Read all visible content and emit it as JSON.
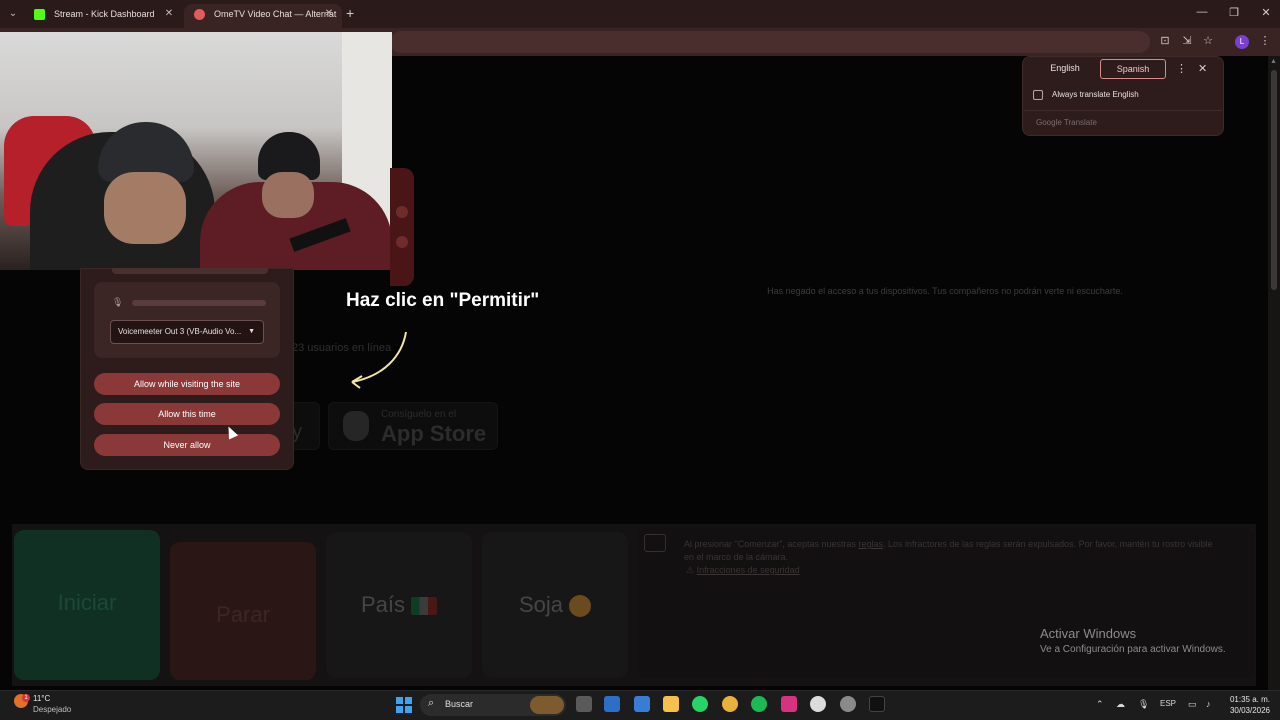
{
  "browser": {
    "tabs": [
      {
        "title": "Stream - Kick Dashboard",
        "active": false
      },
      {
        "title": "OmeTV Video Chat — Alternat",
        "active": true
      }
    ]
  },
  "page": {
    "denied_message": "Has negado el acceso a tus dispositivos. Tus compañeros no podrán verte ni escucharte.",
    "online_count": "23 usuarios en línea",
    "app_store": {
      "small": "Consíguelo en el",
      "big": "App Store"
    },
    "google_play_fragment": "by",
    "controls": {
      "start": "Iniciar",
      "stop": "Parar",
      "country": "País",
      "gender": "Soja"
    },
    "terms": {
      "text_before_link": "Al presionar \"Comenzar\", aceptas nuestras ",
      "link": "reglas",
      "text_after_link": ". Los infractores de las reglas serán expulsados. Por favor, mantén tu rostro visible en el marco de la cámara.",
      "rules_link": "Infracciones de seguridad"
    },
    "hint": "Haz clic en \"Permitir\""
  },
  "permission_dialog": {
    "device_select": "Voicemeeter Out 3 (VB-Audio Vo...",
    "buttons": {
      "allow_visit": "Allow while visiting the site",
      "allow_once": "Allow this time",
      "never": "Never allow"
    }
  },
  "translate_popup": {
    "lang_from": "English",
    "lang_to": "Spanish",
    "always_label": "Always translate English",
    "brand": "Google Translate"
  },
  "watermark": {
    "title": "Activar Windows",
    "subtitle": "Ve a Configuración para activar Windows."
  },
  "taskbar": {
    "temperature": "11°C",
    "condition": "Despejado",
    "search_placeholder": "Buscar",
    "language": "ESP",
    "time": "01:35 a. m.",
    "date": "30/03/2026"
  },
  "colors": {
    "tab_strip": "#2b1a1a",
    "toolbar": "#3a2323",
    "dialog_button": "#8a3838",
    "kick_green": "#53fc18"
  },
  "icons": [
    "tab-search-icon",
    "kick-favicon",
    "ometv-favicon",
    "close-icon",
    "new-tab-icon",
    "minimize-icon",
    "maximize-icon",
    "translate-icon",
    "install-icon",
    "star-icon",
    "profile-avatar",
    "kebab-menu-icon",
    "microphone-icon",
    "chevron-down-icon",
    "apple-icon",
    "windows-start-icon",
    "search-icon"
  ]
}
